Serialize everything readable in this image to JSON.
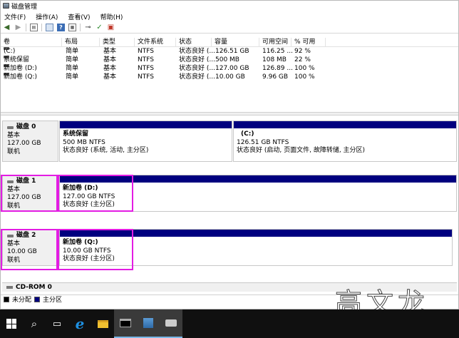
{
  "window": {
    "title": "磁盘管理"
  },
  "menu": [
    "文件(F)",
    "操作(A)",
    "查看(V)",
    "帮助(H)"
  ],
  "toolbar_icons": [
    "back-arrow-icon",
    "forward-arrow-icon",
    "console-tree-icon",
    "properties-icon",
    "help-icon",
    "view-icon",
    "connect-icon",
    "check-icon",
    "delete-icon"
  ],
  "volume_table": {
    "headers": [
      "卷",
      "布局",
      "类型",
      "文件系统",
      "状态",
      "容量",
      "可用空间",
      "% 可用"
    ],
    "rows": [
      [
        "(C:)",
        "简单",
        "基本",
        "NTFS",
        "状态良好 (...",
        "126.51 GB",
        "116.25 ...",
        "92 %"
      ],
      [
        "系统保留",
        "简单",
        "基本",
        "NTFS",
        "状态良好 (...",
        "500 MB",
        "108 MB",
        "22 %"
      ],
      [
        "新加卷 (D:)",
        "简单",
        "基本",
        "NTFS",
        "状态良好 (...",
        "127.00 GB",
        "126.89 ...",
        "100 %"
      ],
      [
        "新加卷 (Q:)",
        "简单",
        "基本",
        "NTFS",
        "状态良好 (...",
        "10.00 GB",
        "9.96 GB",
        "100 %"
      ]
    ]
  },
  "disks": [
    {
      "name": "磁盘 0",
      "type": "基本",
      "size": "127.00 GB",
      "status": "联机",
      "partitions": [
        {
          "title": "系统保留",
          "size": "500 MB NTFS",
          "status": "状态良好 (系统, 活动, 主分区)"
        },
        {
          "title": "(C:)",
          "size": "126.51 GB NTFS",
          "status": "状态良好 (启动, 页面文件, 故障转储, 主分区)"
        }
      ]
    },
    {
      "name": "磁盘 1",
      "type": "基本",
      "size": "127.00 GB",
      "status": "联机",
      "partitions": [
        {
          "title": "新加卷 (D:)",
          "size": "127.00 GB NTFS",
          "status": "状态良好 (主分区)"
        }
      ]
    },
    {
      "name": "磁盘 2",
      "type": "基本",
      "size": "10.00 GB",
      "status": "联机",
      "partitions": [
        {
          "title": "新加卷 (Q:)",
          "size": "10.00 GB NTFS",
          "status": "状态良好 (主分区)"
        }
      ]
    }
  ],
  "cdrom": {
    "name": "CD-ROM 0"
  },
  "legend": {
    "unallocated": "未分配",
    "primary": "主分区"
  },
  "colors": {
    "primary_partition": "#00007f",
    "highlight": "#e31ce3",
    "taskbar": "#101010"
  },
  "watermark": "高文龙",
  "taskbar_icons": [
    "windows-start-icon",
    "search-icon",
    "task-view-icon",
    "internet-explorer-icon",
    "file-explorer-icon",
    "command-prompt-icon",
    "server-manager-icon",
    "disk-management-icon"
  ]
}
